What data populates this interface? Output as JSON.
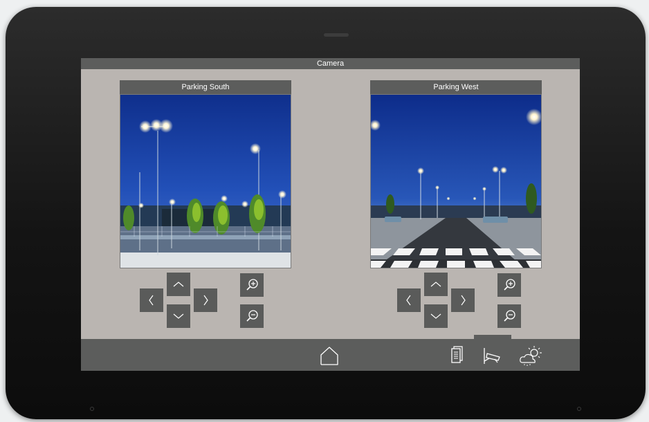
{
  "screen": {
    "title": "Camera"
  },
  "cameras": [
    {
      "name": "Parking South"
    },
    {
      "name": "Parking West"
    }
  ],
  "icons": {
    "nav_up": "chevron-up-icon",
    "nav_down": "chevron-down-icon",
    "nav_left": "chevron-left-icon",
    "nav_right": "chevron-right-icon",
    "zoom_in": "zoom-in-icon",
    "zoom_out": "zoom-out-icon",
    "home": "home-icon",
    "document": "document-icon",
    "camera": "security-camera-icon",
    "weather": "weather-icon"
  },
  "active_nav": "camera",
  "colors": {
    "bezel": "#141414",
    "screen_bg": "#bab5b1",
    "bar": "#5c5d5c",
    "button": "#5a5b5a",
    "icon": "#ffffff"
  }
}
